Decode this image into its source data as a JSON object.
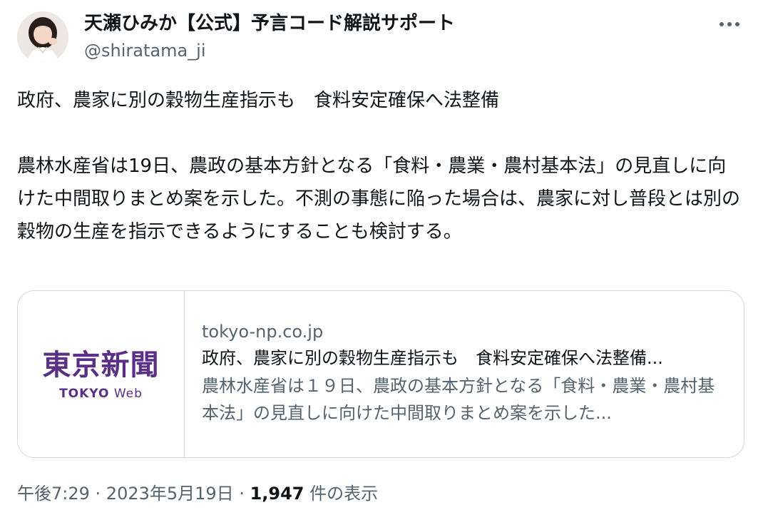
{
  "author": {
    "display_name": "天瀬ひみか【公式】予言コード解説サポート",
    "handle": "@shiratama_ji",
    "avatar_icon": "avatar-photo"
  },
  "more_icon": "more-horizontal-icon",
  "tweet": {
    "text": "政府、農家に別の穀物生産指示も　食料安定確保へ法整備\n\n農林水産省は19日、農政の基本方針となる「食料・農業・農村基本法」の見直しに向けた中間取りまとめ案を示した。不測の事態に陥った場合は、農家に対し普段とは別の穀物の生産を指示できるようにすることも検討する。"
  },
  "card": {
    "logo_kanji": "東京新聞",
    "logo_sub_bold": "TOKYO",
    "logo_sub_light": "Web",
    "domain": "tokyo-np.co.jp",
    "title": "政府、農家に別の穀物生産指示も　食料安定確保へ法整備...",
    "description": "農林水産省は１９日、農政の基本方針となる「食料・農業・農村基本法」の見直しに向けた中間取りまとめ案を示した..."
  },
  "meta": {
    "time": "午後7:29",
    "separator": " · ",
    "date": "2023年5月19日",
    "views_count": "1,947",
    "views_label": " 件の表示"
  },
  "colors": {
    "text_primary": "#0f1419",
    "text_secondary": "#536471",
    "border": "#cfd9de",
    "logo_purple": "#5a2f87"
  }
}
